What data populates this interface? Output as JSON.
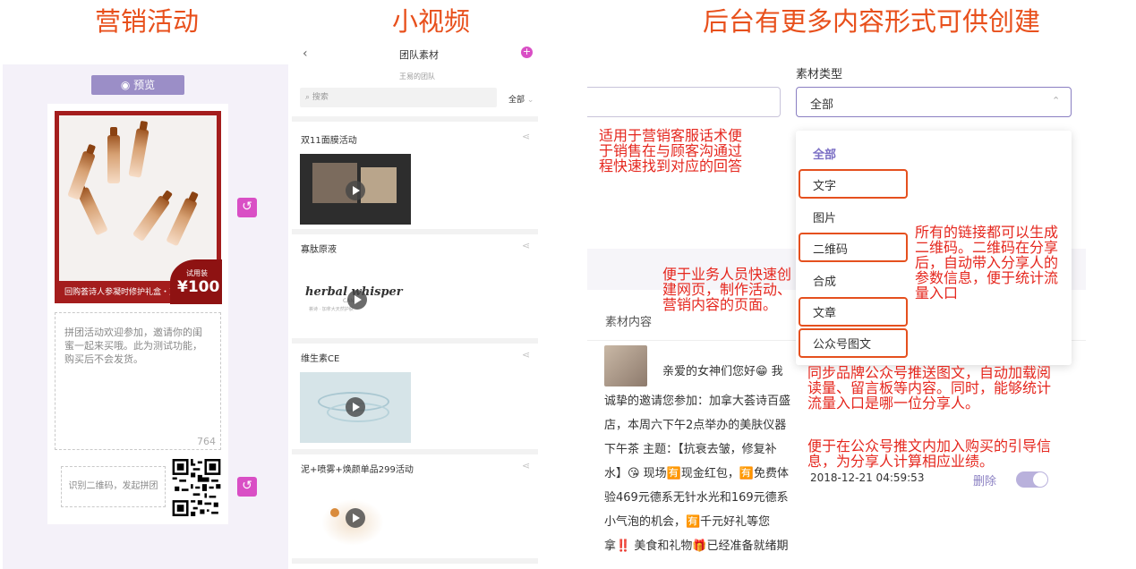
{
  "titles": {
    "left": "营销活动",
    "mid": "小视频",
    "right": "后台有更多内容形式可供创建"
  },
  "left": {
    "preview_label": "预览",
    "poster_banner": "回购荟诗人参凝时修护礼盒・直降100",
    "price_tag": "试用装",
    "price": "¥100",
    "textarea_text": "拼团活动欢迎参加，邀请你的闺蜜一起来买哦。此为测试功能，购买后不会发货。",
    "char_count": "764",
    "qr_hint": "识别二维码，发起拼团"
  },
  "mid": {
    "header_title": "团队素材",
    "header_sub": "王易的团队",
    "search_placeholder": "搜索",
    "filter": "全部",
    "items": [
      {
        "title": "双11面膜活动"
      },
      {
        "title": "寡肽原液",
        "brand": "herbal whisper",
        "brand_sub": "CAN",
        "brand_cn": "荟诗 · 加拿大天然护肤"
      },
      {
        "title": "维生素CE"
      },
      {
        "title": "泥+喷雾+焕颜单品299活动"
      }
    ]
  },
  "right": {
    "type_label": "素材类型",
    "select_value": "全部",
    "options": [
      "全部",
      "文字",
      "图片",
      "二维码",
      "合成",
      "文章",
      "公众号图文"
    ],
    "content_label": "素材内容",
    "post_text_first": "亲爱的女神们您好😁 我",
    "post_text": "诚挚的邀请您参加：加拿大荟诗百盛店，本周六下午2点举办的美肤仪器下午茶 主题：【抗衰去皱，修复补水】😘 现场🈶现金红包，🈶免费体验469元德系无针水光和169元德系小气泡的机会，🈶千元好礼等您拿‼️ 美食和礼物🎁已经准备就绪期",
    "timestamp": "2018-12-21 04:59:53",
    "delete_label": "删除",
    "notes": {
      "text_note": "适用于营销客服话术便于销售在与顾客沟通过程快速找到对应的回答",
      "article_note": "便于业务人员快速创建网页，制作活动、营销内容的页面。",
      "qr_note": "所有的链接都可以生成二维码。二维码在分享后，自动带入分享人的参数信息，便于统计流量入口",
      "wechat_note": "同步品牌公众号推送图文，自动加载阅读量、留言板等内容。同时，能够统计流量入口是哪一位分享人。",
      "buy_note": "便于在公众号推文内加入购买的引导信息，为分享人计算相应业绩。"
    }
  },
  "colors": {
    "accent": "#e8501c",
    "note": "#e5271e",
    "purple": "#9b8ec7"
  }
}
